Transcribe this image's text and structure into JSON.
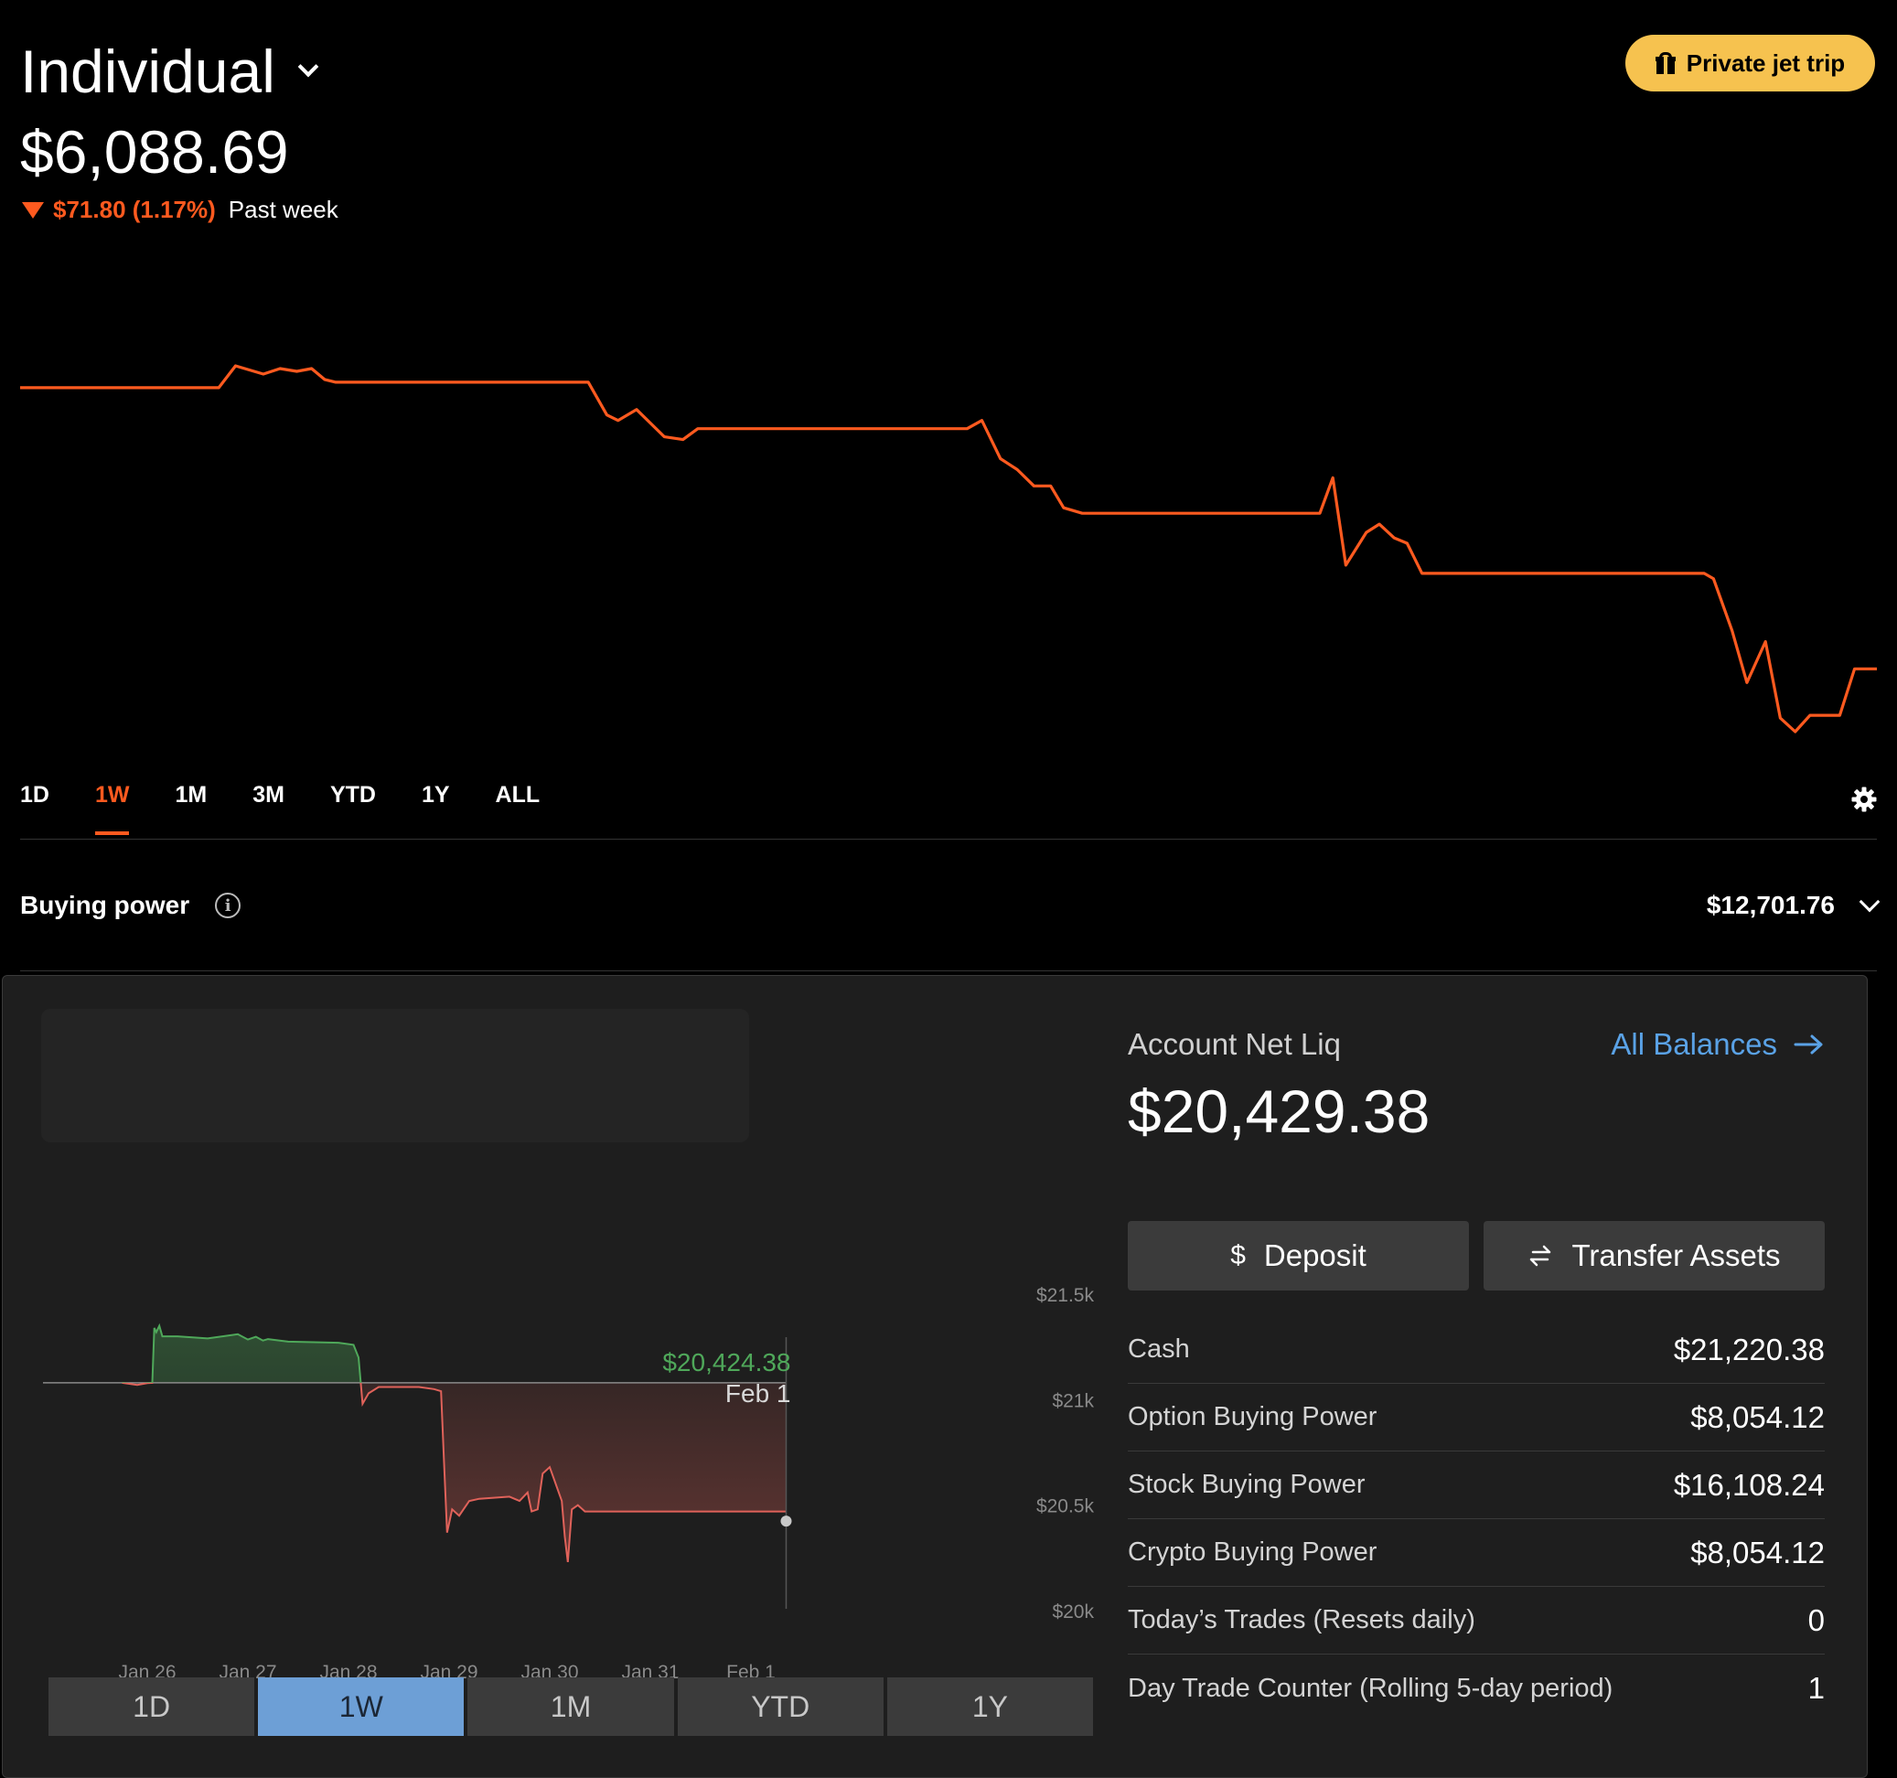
{
  "top": {
    "account_name": "Individual",
    "portfolio_value": "$6,088.69",
    "change_amount": "$71.80 (1.17%)",
    "change_period": "Past week",
    "promo_label": "Private jet trip",
    "line_color": "#ff5a1f",
    "ranges": [
      "1D",
      "1W",
      "1M",
      "3M",
      "YTD",
      "1Y",
      "ALL"
    ],
    "active_range": "1W",
    "buying_power_label": "Buying power",
    "buying_power_value": "$12,701.76"
  },
  "bottom": {
    "net_liq_label": "Account Net Liq",
    "net_liq_value": "$20,429.38",
    "all_balances_label": "All Balances",
    "deposit_label": "Deposit",
    "transfer_label": "Transfer Assets",
    "balances": [
      {
        "label": "Cash",
        "value": "$21,220.38"
      },
      {
        "label": "Option Buying Power",
        "value": "$8,054.12"
      },
      {
        "label": "Stock Buying Power",
        "value": "$16,108.24"
      },
      {
        "label": "Crypto Buying Power",
        "value": "$8,054.12"
      },
      {
        "label": "Today’s Trades (Resets daily)",
        "value": "0"
      },
      {
        "label": "Day Trade Counter (Rolling 5-day period)",
        "value": "1"
      }
    ],
    "ranges": [
      "1D",
      "1W",
      "1M",
      "YTD",
      "1Y"
    ],
    "active_range": "1W",
    "accent_color": "#6d9fd6"
  },
  "chart_data": [
    {
      "type": "line",
      "title": "",
      "x_unit": "fraction of week (0 = start, 1 = now)",
      "y_unit": "relative level (no axis shown)",
      "series": [
        {
          "color": "#ff5a1f",
          "points": [
            [
              0.0,
              6158
            ],
            [
              0.107,
              6158
            ],
            [
              0.116,
              6166
            ],
            [
              0.131,
              6163
            ],
            [
              0.14,
              6165
            ],
            [
              0.149,
              6164
            ],
            [
              0.157,
              6165
            ],
            [
              0.164,
              6161
            ],
            [
              0.17,
              6160
            ],
            [
              0.306,
              6160
            ],
            [
              0.316,
              6148
            ],
            [
              0.322,
              6146
            ],
            [
              0.332,
              6150
            ],
            [
              0.347,
              6140
            ],
            [
              0.357,
              6139
            ],
            [
              0.365,
              6143
            ],
            [
              0.51,
              6143
            ],
            [
              0.518,
              6146
            ],
            [
              0.528,
              6132
            ],
            [
              0.537,
              6128
            ],
            [
              0.546,
              6122
            ],
            [
              0.555,
              6122
            ],
            [
              0.562,
              6114
            ],
            [
              0.572,
              6112
            ],
            [
              0.7,
              6112
            ],
            [
              0.707,
              6125
            ],
            [
              0.714,
              6093
            ],
            [
              0.725,
              6105
            ],
            [
              0.732,
              6108
            ],
            [
              0.74,
              6103
            ],
            [
              0.747,
              6101
            ],
            [
              0.755,
              6090
            ],
            [
              0.907,
              6090
            ],
            [
              0.912,
              6088
            ],
            [
              0.922,
              6069
            ],
            [
              0.93,
              6050
            ],
            [
              0.94,
              6065
            ],
            [
              0.948,
              6037
            ],
            [
              0.956,
              6032
            ],
            [
              0.964,
              6038
            ],
            [
              0.98,
              6038
            ],
            [
              0.988,
              6055
            ],
            [
              1.0,
              6055
            ]
          ]
        }
      ]
    },
    {
      "type": "area",
      "title": "",
      "x_unit": "days since Jan 26",
      "categories": [
        "Jan 26",
        "Jan 27",
        "Jan 28",
        "Jan 29",
        "Jan 30",
        "Jan 31",
        "Feb 1"
      ],
      "y_ticks": [
        "$21.5k",
        "$21k",
        "$20.5k",
        "$20k"
      ],
      "ylim": [
        20000,
        21500
      ],
      "baseline": 21080,
      "up_color": "#4fa85a",
      "down_color": "#e0625a",
      "last_value_label": "$20,424.38",
      "last_date_label": "Feb 1",
      "last_value": 20424.38,
      "series": [
        {
          "name": "Net Liq",
          "points": [
            [
              -0.25,
              21080
            ],
            [
              -0.1,
              21070
            ],
            [
              0.0,
              21078
            ],
            [
              0.05,
              21080
            ],
            [
              0.07,
              21340
            ],
            [
              0.09,
              21320
            ],
            [
              0.12,
              21350
            ],
            [
              0.15,
              21300
            ],
            [
              0.3,
              21300
            ],
            [
              0.6,
              21290
            ],
            [
              0.9,
              21310
            ],
            [
              1.0,
              21285
            ],
            [
              1.08,
              21298
            ],
            [
              1.15,
              21280
            ],
            [
              1.2,
              21287
            ],
            [
              1.4,
              21275
            ],
            [
              1.9,
              21270
            ],
            [
              2.05,
              21260
            ],
            [
              2.1,
              21200
            ],
            [
              2.14,
              20980
            ],
            [
              2.2,
              21030
            ],
            [
              2.3,
              21060
            ],
            [
              2.7,
              21060
            ],
            [
              2.85,
              21050
            ],
            [
              2.92,
              21040
            ],
            [
              2.95,
              20700
            ],
            [
              2.98,
              20370
            ],
            [
              3.03,
              20480
            ],
            [
              3.1,
              20450
            ],
            [
              3.2,
              20520
            ],
            [
              3.3,
              20530
            ],
            [
              3.6,
              20540
            ],
            [
              3.7,
              20520
            ],
            [
              3.78,
              20560
            ],
            [
              3.82,
              20470
            ],
            [
              3.88,
              20480
            ],
            [
              3.93,
              20650
            ],
            [
              4.0,
              20680
            ],
            [
              4.06,
              20600
            ],
            [
              4.12,
              20520
            ],
            [
              4.15,
              20350
            ],
            [
              4.18,
              20230
            ],
            [
              4.22,
              20480
            ],
            [
              4.28,
              20500
            ],
            [
              4.35,
              20470
            ],
            [
              5.0,
              20470
            ],
            [
              6.0,
              20470
            ],
            [
              6.35,
              20470
            ]
          ]
        }
      ]
    }
  ]
}
